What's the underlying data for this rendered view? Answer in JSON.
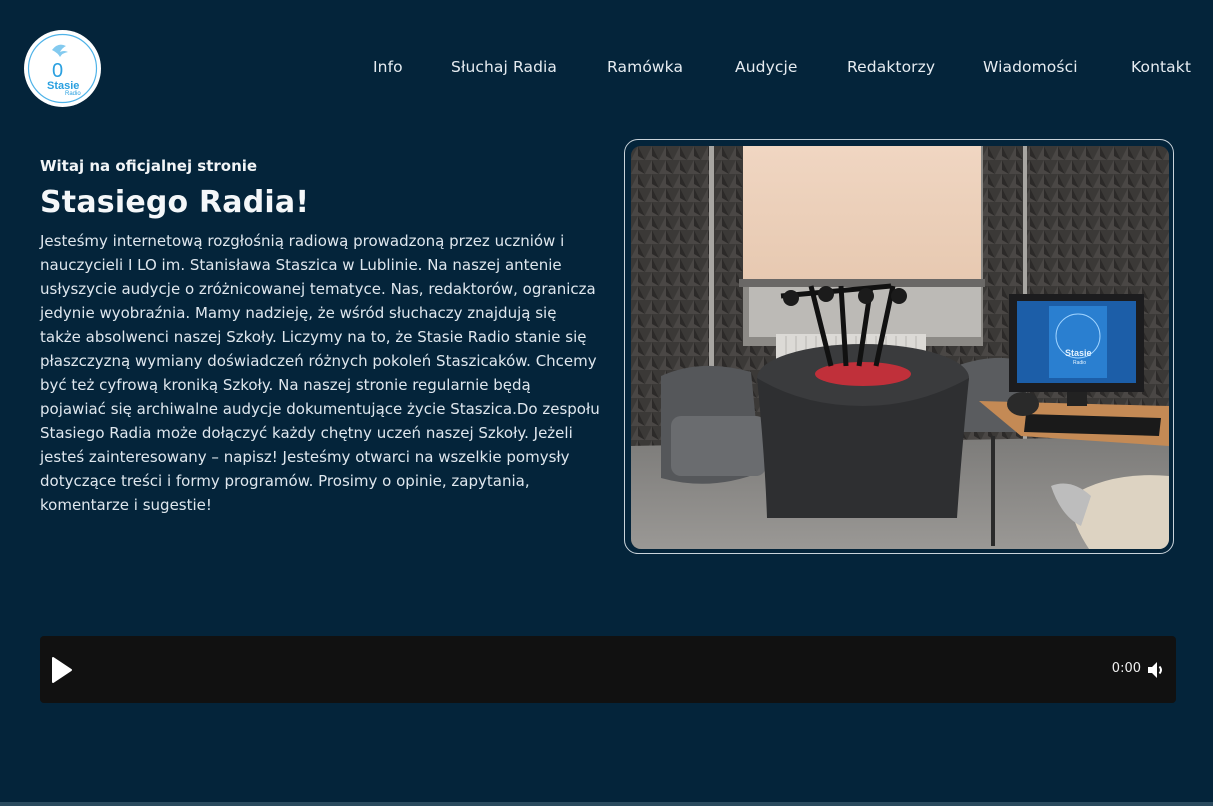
{
  "logo": {
    "name": "Stasie",
    "sub": "Radio",
    "digit": "0"
  },
  "nav": {
    "items": [
      "Info",
      "Słuchaj Radia",
      "Ramówka",
      "Audycje",
      "Redaktorzy",
      "Wiadomości",
      "Kontakt"
    ]
  },
  "intro": {
    "kicker": "Witaj na oficjalnej stronie",
    "title": "Stasiego Radia!",
    "body": "Jesteśmy internetową rozgłośnią radiową prowadzoną przez uczniów i nauczycieli I LO im. Stanisława Staszica w Lublinie. Na naszej antenie usłyszycie audycje o zróżnicowanej tematyce. Nas, redaktorów, ogranicza jedynie wyobraźnia. Mamy nadzieję, że wśród słuchaczy znajdują się także absolwenci naszej Szkoły. Liczymy na to, że Stasie Radio stanie się płaszczyzną wymiany doświadczeń różnych pokoleń Staszicaków. Chcemy być też cyfrową kroniką Szkoły. Na naszej stronie regularnie będą pojawiać się archiwalne audycje dokumentujące życie Staszica.Do zespołu Stasiego Radia może dołączyć każdy chętny uczeń naszej Szkoły. Jeżeli jesteś zainteresowany – napisz! Jesteśmy otwarci na wszelkie pomysły dotyczące treści i formy programów. Prosimy o opinie, zapytania, komentarze i sugestie!"
  },
  "photo": {
    "screen_logo_name": "Stasie",
    "screen_logo_sub": "Radio"
  },
  "player": {
    "time": "0:00"
  },
  "colors": {
    "background": "#04243a",
    "accent": "#2aa0e0"
  }
}
